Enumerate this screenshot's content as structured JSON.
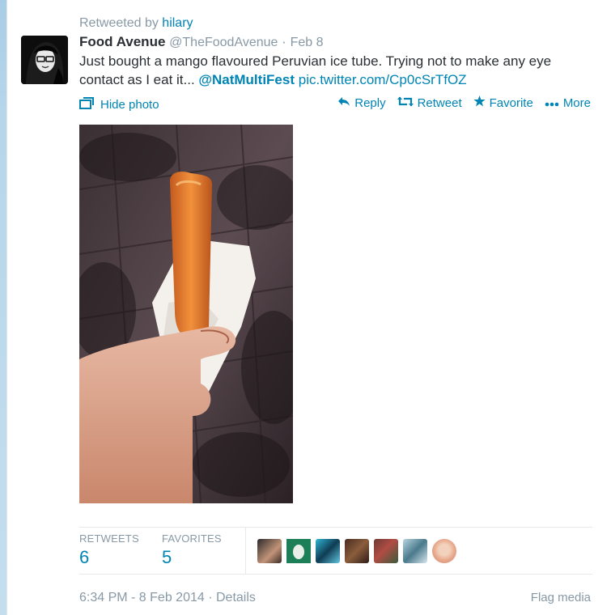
{
  "retweet": {
    "prefix": "Retweeted by",
    "user": "hilary"
  },
  "tweet": {
    "name": "Food Avenue",
    "handle": "@TheFoodAvenue",
    "separator": "·",
    "date": "Feb 8",
    "text_before": "Just bought a mango flavoured Peruvian ice tube. Trying not to make any eye contact as I eat it...",
    "mention": "@NatMultiFest",
    "pic_link": "pic.twitter.com/Cp0cSrTfOZ"
  },
  "media_toggle": {
    "label": "Hide photo",
    "icon": "photo-icon"
  },
  "actions": [
    {
      "label": "Reply",
      "icon": "reply-icon"
    },
    {
      "label": "Retweet",
      "icon": "retweet-icon"
    },
    {
      "label": "Favorite",
      "icon": "star-icon"
    },
    {
      "label": "More",
      "icon": "more-icon"
    }
  ],
  "stats": {
    "retweets_label": "RETWEETS",
    "retweets_count": "6",
    "favorites_label": "FAVORITES",
    "favorites_count": "5"
  },
  "footer": {
    "timestamp": "6:34 PM - 8 Feb 2014",
    "separator": "·",
    "details": "Details",
    "flag": "Flag media"
  },
  "colors": {
    "link": "#0084b4",
    "muted": "#8899a6",
    "text": "#292f33"
  }
}
